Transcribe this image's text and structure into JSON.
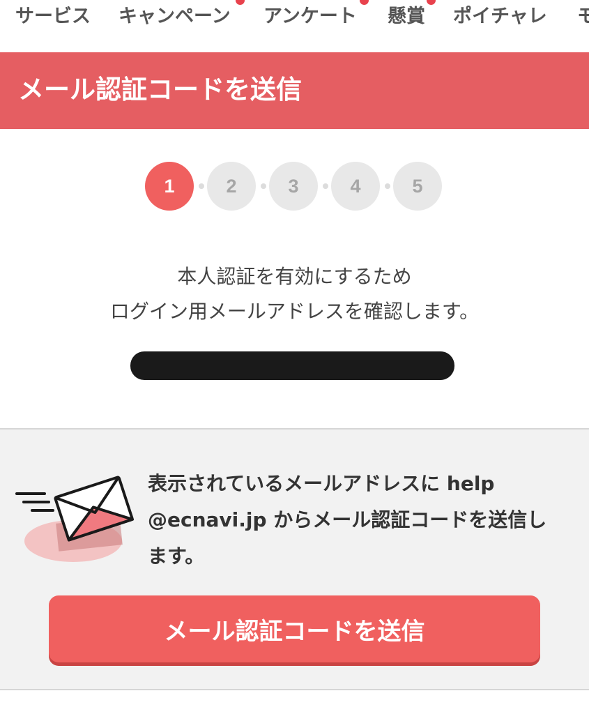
{
  "nav": {
    "items": [
      {
        "label": "サービス",
        "has_dot": false
      },
      {
        "label": "キャンペーン",
        "has_dot": true
      },
      {
        "label": "アンケート",
        "has_dot": true
      },
      {
        "label": "懸賞",
        "has_dot": true
      },
      {
        "label": "ポイチャレ",
        "has_dot": false
      },
      {
        "label": "モ",
        "has_dot": false
      }
    ]
  },
  "banner": {
    "title": "メール認証コードを送信"
  },
  "steps": {
    "items": [
      "1",
      "2",
      "3",
      "4",
      "5"
    ],
    "current": 1
  },
  "intro": {
    "line1": "本人認証を有効にするため",
    "line2": "ログイン用メールアドレスを確認します。"
  },
  "notice": {
    "text": "表示されているメールアドレスに help @ecnavi.jp からメール認証コードを送信します。"
  },
  "send_button": {
    "label": "メール認証コードを送信"
  },
  "colors": {
    "accent": "#f0605f",
    "banner": "#e55e62",
    "dot": "#e8424d"
  }
}
